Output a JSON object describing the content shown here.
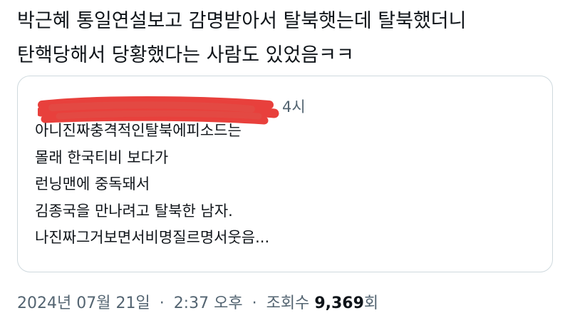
{
  "tweet": {
    "text_lines": [
      "박근혜 통일연설보고 감명받아서 탈북햇는데 탈북했더니",
      "탄핵당해서 당황했다는 사람도 있었음ㅋㅋ"
    ]
  },
  "quote": {
    "time": "4시",
    "body_lines": [
      "아니진짜충격적인탈북에피소드는",
      "몰래 한국티비 보다가",
      "런닝맨에 중독돼서",
      "김종국을 만나려고 탈북한 남자.",
      "나진짜그거보면서비명질르명서웃음..."
    ],
    "redaction_color": "#e8403c"
  },
  "meta": {
    "date": "2024년 07월 21일",
    "separator": "·",
    "time": "2:37 오후",
    "views_label": "조회수",
    "views_count": "9,369",
    "views_unit": "회"
  }
}
